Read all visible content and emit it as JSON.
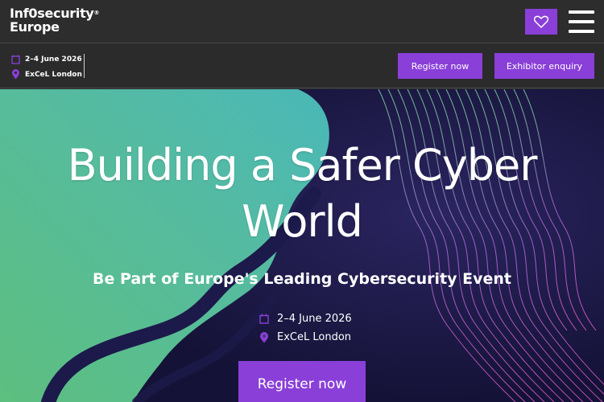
{
  "header": {
    "logo_line1": "Inf0security",
    "logo_line2": "Europe",
    "logo_tm": "®",
    "heart_icon": "heart-icon",
    "menu_icon": "hamburger-menu-icon"
  },
  "subbar": {
    "date": "2–4 June 2026",
    "venue": "ExCeL London",
    "register_label": "Register now",
    "exhibitor_label": "Exhibitor enquiry"
  },
  "hero": {
    "title_line1": "Building a Safer Cyber",
    "title_line2": "World",
    "subtitle": "Be Part of Europe's Leading Cybersecurity Event",
    "date": "2–4 June 2026",
    "venue": "ExCeL London",
    "cta_label": "Register now"
  },
  "colors": {
    "accent": "#8a3fd8",
    "topbar_bg": "#2d2d2d",
    "hero_green": "#5dbf8a",
    "hero_teal": "#4fb7b0",
    "hero_navy": "#1c1a4a"
  }
}
